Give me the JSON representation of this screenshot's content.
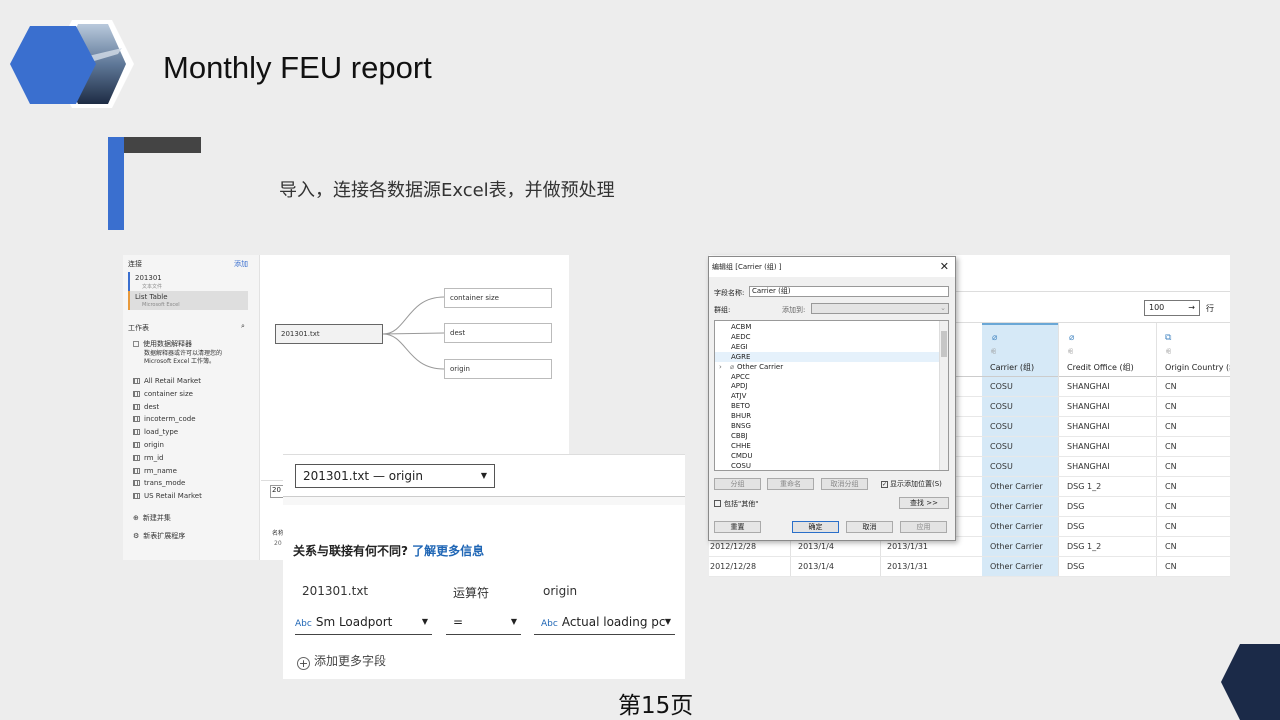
{
  "title": "Monthly FEU report",
  "subtitle": "导入，连接各数据源Excel表，并做预处理",
  "page_number": "第15页",
  "colors": {
    "accent_blue": "#3a6fcf",
    "navy": "#1b2a48",
    "dark_gray": "#444444"
  },
  "connections_panel": {
    "header": "连接",
    "add_link": "添加",
    "items": [
      {
        "name": "201301",
        "type": "文本文件"
      },
      {
        "name": "List Table",
        "type": "Microsoft Excel"
      }
    ],
    "sheets_header": "工作表",
    "interpreter_label": "使用数据解释器",
    "interpreter_desc": "数据解释器或许可以清理您的 Microsoft Excel 工作簿。",
    "sheets": [
      "All Retail Market",
      "container size",
      "dest",
      "incoterm_code",
      "load_type",
      "origin",
      "rm_id",
      "rm_name",
      "trans_mode",
      "US Retail Market"
    ],
    "new_union": "新建并集",
    "new_extension": "新表扩展程序"
  },
  "canvas": {
    "root": "201301.txt",
    "children": [
      "container size",
      "dest",
      "origin"
    ],
    "name_label": "名称",
    "row_stub": "20"
  },
  "join_dialog": {
    "selector": "201301.txt  —  origin",
    "question": "关系与联接有何不同?",
    "learn_more": "了解更多信息",
    "left_source": "201301.txt",
    "operator_header": "运算符",
    "right_source": "origin",
    "left_field": "Sm Loadport",
    "operator": "=",
    "right_field": "Actual loading pc",
    "type_badge": "Abc",
    "add_field": "添加更多字段"
  },
  "data_table": {
    "rows_value": "100",
    "rows_unit": "行",
    "columns": [
      {
        "name": "Carrier (组)",
        "icon": "paperclip-icon"
      },
      {
        "name": "Credit Office (组)",
        "icon": "paperclip-icon"
      },
      {
        "name": "Origin Country (组)",
        "icon": "group-icon"
      }
    ],
    "sub_label": "组",
    "rows": [
      {
        "c1": "",
        "c2": "",
        "c3": "",
        "carrier": "COSU",
        "office": "SHANGHAI",
        "country": "CN"
      },
      {
        "c1": "",
        "c2": "",
        "c3": "",
        "carrier": "COSU",
        "office": "SHANGHAI",
        "country": "CN"
      },
      {
        "c1": "",
        "c2": "",
        "c3": "",
        "carrier": "COSU",
        "office": "SHANGHAI",
        "country": "CN"
      },
      {
        "c1": "",
        "c2": "",
        "c3": "",
        "carrier": "COSU",
        "office": "SHANGHAI",
        "country": "CN"
      },
      {
        "c1": "",
        "c2": "",
        "c3": "",
        "carrier": "COSU",
        "office": "SHANGHAI",
        "country": "CN"
      },
      {
        "c1": "",
        "c2": "",
        "c3": "",
        "carrier": "Other Carrier",
        "office": "DSG 1_2",
        "country": "CN"
      },
      {
        "c1": "",
        "c2": "",
        "c3": "",
        "carrier": "Other Carrier",
        "office": "DSG",
        "country": "CN"
      },
      {
        "c1": "",
        "c2": "",
        "c3": "",
        "carrier": "Other Carrier",
        "office": "DSG",
        "country": "CN"
      },
      {
        "c1": "2012/12/28",
        "c2": "2013/1/4",
        "c3": "2013/1/31",
        "carrier": "Other Carrier",
        "office": "DSG 1_2",
        "country": "CN"
      },
      {
        "c1": "2012/12/28",
        "c2": "2013/1/4",
        "c3": "2013/1/31",
        "carrier": "Other Carrier",
        "office": "DSG",
        "country": "CN"
      }
    ]
  },
  "edit_group_dialog": {
    "title": "编辑组 [Carrier (组) ]",
    "field_name_label": "字段名称:",
    "field_name_value": "Carrier (组)",
    "group_label": "群组:",
    "add_to_label": "添加到:",
    "items": [
      "ACBM",
      "AEDC",
      "AEGI",
      "AGRE",
      "Other Carrier",
      "APCC",
      "APDJ",
      "ATJV",
      "BETO",
      "BHUR",
      "BNSG",
      "CBBJ",
      "CHHE",
      "CMDU",
      "COSU"
    ],
    "group_btn": "分组",
    "rename_btn": "重命名",
    "ungroup_btn": "取消分组",
    "show_added_label": "显示添加位置(S)",
    "include_other_label": "包括\"其他\"",
    "find_btn": "查找 >>",
    "reset_btn": "重置",
    "ok_btn": "确定",
    "cancel_btn": "取消",
    "apply_btn": "应用"
  }
}
